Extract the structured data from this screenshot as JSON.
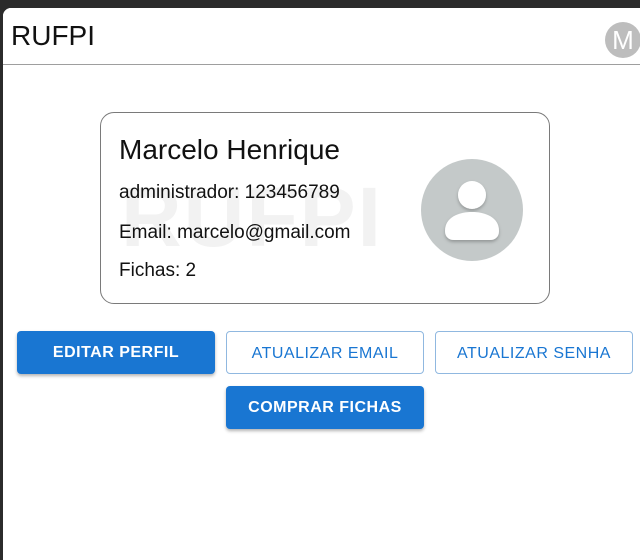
{
  "app": {
    "title": "RUFPI",
    "user_initial": "M"
  },
  "profile": {
    "watermark": "RUFPI",
    "name": "Marcelo Henrique",
    "role_line": "administrador: 123456789",
    "email_line": "Email: marcelo@gmail.com",
    "tokens_line": "Fichas: 2",
    "avatar_icon": "person-icon"
  },
  "actions": {
    "edit_profile": "EDITAR PERFIL",
    "update_email": "ATUALIZAR EMAIL",
    "update_password": "ATUALIZAR SENHA",
    "buy_tokens": "COMPRAR FICHAS"
  },
  "colors": {
    "primary": "#1976d2",
    "avatar_bg": "#c4c9c9",
    "small_avatar_bg": "#bdbdbd"
  }
}
